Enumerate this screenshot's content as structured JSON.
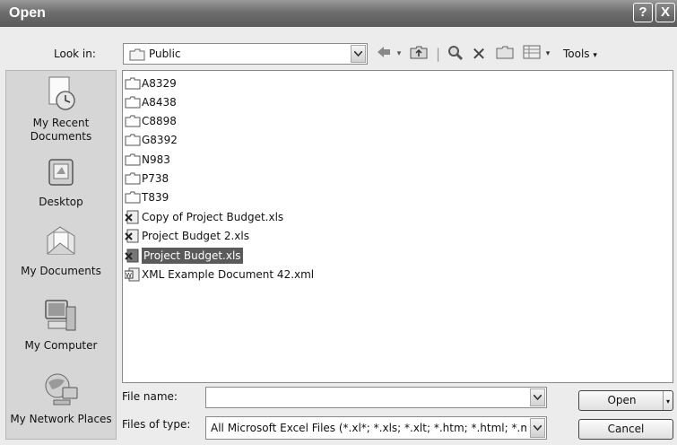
{
  "window": {
    "title": "Open",
    "help_label": "?",
    "close_label": "X"
  },
  "look_in": {
    "label": "Look in:",
    "value": "Public"
  },
  "toolbar": {
    "tools_label": "Tools"
  },
  "places": [
    {
      "label": "My Recent Documents",
      "icon": "recent-documents-icon"
    },
    {
      "label": "Desktop",
      "icon": "desktop-icon"
    },
    {
      "label": "My Documents",
      "icon": "my-documents-icon"
    },
    {
      "label": "My Computer",
      "icon": "my-computer-icon"
    },
    {
      "label": "My Network Places",
      "icon": "network-places-icon"
    }
  ],
  "files": [
    {
      "name": "A8329",
      "type": "folder"
    },
    {
      "name": "A8438",
      "type": "folder"
    },
    {
      "name": "C8898",
      "type": "folder"
    },
    {
      "name": "G8392",
      "type": "folder"
    },
    {
      "name": "N983",
      "type": "folder"
    },
    {
      "name": "P738",
      "type": "folder"
    },
    {
      "name": "T839",
      "type": "folder"
    },
    {
      "name": "Copy of Project Budget.xls",
      "type": "excel"
    },
    {
      "name": "Project Budget 2.xls",
      "type": "excel"
    },
    {
      "name": "Project Budget.xls",
      "type": "excel",
      "selected": true
    },
    {
      "name": "XML Example Document 42.xml",
      "type": "xml"
    }
  ],
  "file_name": {
    "label": "File name:",
    "value": ""
  },
  "file_type": {
    "label": "Files of type:",
    "value": "All Microsoft Excel Files (*.xl*; *.xls; *.xlt; *.htm; *.html; *.mht; *.mhtml"
  },
  "buttons": {
    "open": "Open",
    "cancel": "Cancel"
  },
  "colors": {
    "title_bar": "#6e6e6e",
    "selection": "#5a5a5a",
    "places_bg": "#d6d6d6"
  }
}
